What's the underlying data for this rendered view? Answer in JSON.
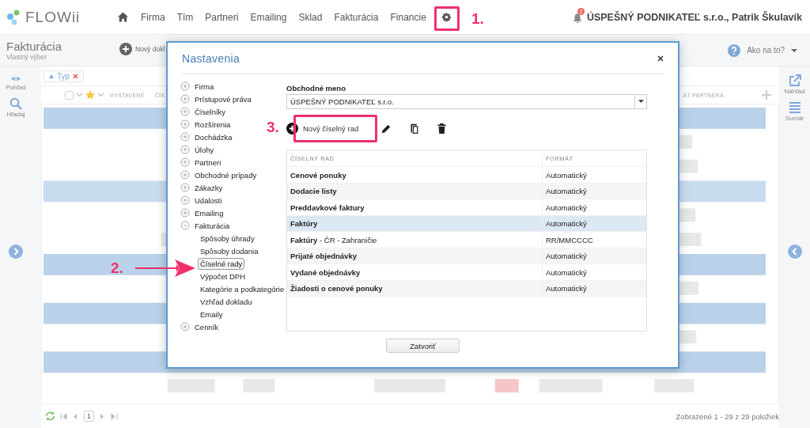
{
  "app": {
    "logo": "FLOWii"
  },
  "nav": [
    {
      "label": "Firma"
    },
    {
      "label": "Tím"
    },
    {
      "label": "Partneri"
    },
    {
      "label": "Emailing"
    },
    {
      "label": "Sklad"
    },
    {
      "label": "Fakturácia"
    },
    {
      "label": "Financie"
    }
  ],
  "user": {
    "notifications": "2",
    "name": "ÚSPEŠNÝ PODNIKATEĽ s.r.o., Patrik Škulavík"
  },
  "page": {
    "title": "Fakturácia",
    "subtitle": "Vlastný výber",
    "new_button": "Nový dokl",
    "help": "Ako na to?"
  },
  "left_rail": [
    {
      "label": "Pohľad"
    },
    {
      "label": "Hľadaj"
    }
  ],
  "right_rail": [
    {
      "label": "Náhľad"
    },
    {
      "label": "Sumár"
    }
  ],
  "filter_chip": {
    "label": "Typ"
  },
  "table_header": {
    "left": [
      "VYSTAVENÉ",
      "ČÍS"
    ],
    "right": "ÁT PARTNERA"
  },
  "pager": {
    "page": "1",
    "summary": "Zobrazené 1 - 29 z 29 položiek"
  },
  "dialog": {
    "title": "Nastavenia",
    "tree": [
      {
        "label": "Firma",
        "expanded": false
      },
      {
        "label": "Prístupové práva",
        "expanded": false
      },
      {
        "label": "Číselníky",
        "expanded": false
      },
      {
        "label": "Rozšírenia",
        "expanded": false
      },
      {
        "label": "Dochádzka",
        "expanded": false
      },
      {
        "label": "Úlohy",
        "expanded": false
      },
      {
        "label": "Partneri",
        "expanded": false
      },
      {
        "label": "Obchodné prípady",
        "expanded": false
      },
      {
        "label": "Zákazky",
        "expanded": false
      },
      {
        "label": "Udalosti",
        "expanded": false
      },
      {
        "label": "Emailing",
        "expanded": false
      },
      {
        "label": "Fakturácia",
        "expanded": true,
        "children": [
          {
            "label": "Spôsoby úhrady",
            "selected": false
          },
          {
            "label": "Spôsoby dodania",
            "selected": false
          },
          {
            "label": "Číselné rady",
            "selected": true
          },
          {
            "label": "Výpočet DPH",
            "selected": false
          },
          {
            "label": "Kategórie a podkategórie",
            "selected": false
          },
          {
            "label": "Vzhľad dokladu",
            "selected": false
          },
          {
            "label": "Emaily",
            "selected": false
          }
        ]
      },
      {
        "label": "Cenník",
        "expanded": false
      }
    ],
    "company_label": "Obchodné meno",
    "company_value": "ÚSPEŠNÝ PODNIKATEĽ s.r.o.",
    "new_button": "Nový číselný rad",
    "columns": [
      "ČÍSELNÝ RAD",
      "FORMÁT"
    ],
    "rows": [
      {
        "name": "Cenové ponuky",
        "format": "Automatický",
        "selected": false
      },
      {
        "name": "Dodacie listy",
        "format": "Automatický",
        "selected": false
      },
      {
        "name": "Preddavkové faktury",
        "format": "Automatický",
        "selected": false
      },
      {
        "name": "Faktúry",
        "format": "Automatický",
        "selected": true
      },
      {
        "name": "Faktúry",
        "detail": " - ČR - Zahraničie",
        "format": "RR/MMCCCC",
        "selected": false
      },
      {
        "name": "Prijaté objednávky",
        "format": "Automatický",
        "selected": false
      },
      {
        "name": "Vydané objednávky",
        "format": "Automatický",
        "selected": false
      },
      {
        "name": "Žiadosti o cenové ponuky",
        "format": "Automatický",
        "selected": false
      }
    ],
    "close_button": "Zatvoriť"
  },
  "annotations": [
    "1.",
    "2.",
    "3."
  ]
}
